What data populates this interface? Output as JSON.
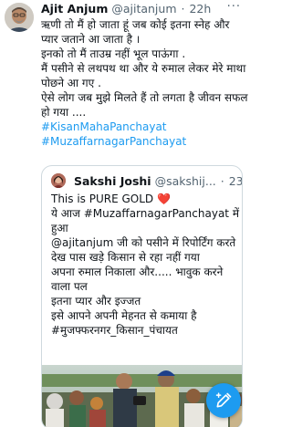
{
  "tweet": {
    "author_name": "Ajit Anjum",
    "author_handle": "@ajitanjum",
    "separator": "·",
    "time": "22h",
    "more_label": "···",
    "lines": [
      "ऋणी तो मैं हो जाता हूं जब कोई इतना स्नेह और",
      "प्यार जताने आ जाता है ।",
      "इनको तो मैं ताउम्र नहीं भूल पाऊंगा .",
      "मैं पसीने से लथपथ था और ये रुमाल लेकर मेरे माथा",
      "पोछने आ गए .",
      "ऐसे लोग जब मुझे मिलते हैं तो लगता है जीवन सफल",
      "हो गया ...."
    ],
    "hashtags": [
      "#KisanMahaPanchayat",
      "#MuzaffarnagarPanchayat"
    ]
  },
  "quote": {
    "author_name": "Sakshi Joshi",
    "author_handle": "@sakshij...",
    "separator": "·",
    "time": "23h",
    "heart": "❤️",
    "lines": [
      "This is PURE GOLD",
      "ये आज #MuzaffarnagarPanchayat में",
      "हुआ",
      "@ajitanjum जी को पसीने में रिपोर्टिंग करते",
      "देख पास खड़े किसान से रहा नहीं गया",
      "अपना रुमाल निकाला और..... भावुक करने",
      "वाला पल",
      "इतना प्यार और इज्जत",
      "इसे आपने अपनी मेहनत से कमाया है",
      "#मुजफ्फरनगर_किसान_पंचायत"
    ]
  },
  "compose": {
    "icon": "compose-icon"
  },
  "colors": {
    "accent": "#1d9bf0",
    "text": "#0f1419",
    "muted": "#536471",
    "heart": "#e0245e",
    "border": "#cfd9de"
  }
}
